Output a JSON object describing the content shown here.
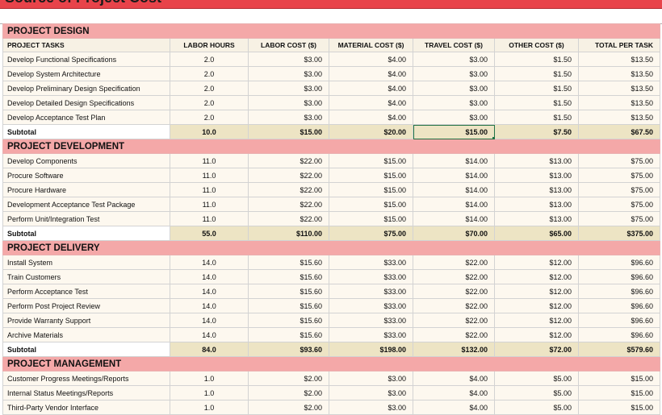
{
  "title": "Source of Project Cost",
  "columns": [
    "PROJECT TASKS",
    "LABOR HOURS",
    "LABOR COST ($)",
    "MATERIAL COST ($)",
    "TRAVEL COST ($)",
    "OTHER COST ($)",
    "TOTAL PER TASK"
  ],
  "sections": [
    {
      "name": "PROJECT DESIGN",
      "rows": [
        [
          "Develop Functional Specifications",
          "2.0",
          "$3.00",
          "$4.00",
          "$3.00",
          "$1.50",
          "$13.50"
        ],
        [
          "Develop System Architecture",
          "2.0",
          "$3.00",
          "$4.00",
          "$3.00",
          "$1.50",
          "$13.50"
        ],
        [
          "Develop Preliminary Design Specification",
          "2.0",
          "$3.00",
          "$4.00",
          "$3.00",
          "$1.50",
          "$13.50"
        ],
        [
          "Develop Detailed Design Specifications",
          "2.0",
          "$3.00",
          "$4.00",
          "$3.00",
          "$1.50",
          "$13.50"
        ],
        [
          "Develop Acceptance Test Plan",
          "2.0",
          "$3.00",
          "$4.00",
          "$3.00",
          "$1.50",
          "$13.50"
        ]
      ],
      "subtotal": [
        "Subtotal",
        "10.0",
        "$15.00",
        "$20.00",
        "$15.00",
        "$7.50",
        "$67.50"
      ]
    },
    {
      "name": "PROJECT DEVELOPMENT",
      "rows": [
        [
          "Develop Components",
          "11.0",
          "$22.00",
          "$15.00",
          "$14.00",
          "$13.00",
          "$75.00"
        ],
        [
          "Procure Software",
          "11.0",
          "$22.00",
          "$15.00",
          "$14.00",
          "$13.00",
          "$75.00"
        ],
        [
          "Procure Hardware",
          "11.0",
          "$22.00",
          "$15.00",
          "$14.00",
          "$13.00",
          "$75.00"
        ],
        [
          "Development Acceptance Test Package",
          "11.0",
          "$22.00",
          "$15.00",
          "$14.00",
          "$13.00",
          "$75.00"
        ],
        [
          "Perform Unit/Integration Test",
          "11.0",
          "$22.00",
          "$15.00",
          "$14.00",
          "$13.00",
          "$75.00"
        ]
      ],
      "subtotal": [
        "Subtotal",
        "55.0",
        "$110.00",
        "$75.00",
        "$70.00",
        "$65.00",
        "$375.00"
      ]
    },
    {
      "name": "PROJECT DELIVERY",
      "rows": [
        [
          "Install System",
          "14.0",
          "$15.60",
          "$33.00",
          "$22.00",
          "$12.00",
          "$96.60"
        ],
        [
          "Train Customers",
          "14.0",
          "$15.60",
          "$33.00",
          "$22.00",
          "$12.00",
          "$96.60"
        ],
        [
          "Perform Acceptance Test",
          "14.0",
          "$15.60",
          "$33.00",
          "$22.00",
          "$12.00",
          "$96.60"
        ],
        [
          "Perform Post Project Review",
          "14.0",
          "$15.60",
          "$33.00",
          "$22.00",
          "$12.00",
          "$96.60"
        ],
        [
          "Provide Warranty Support",
          "14.0",
          "$15.60",
          "$33.00",
          "$22.00",
          "$12.00",
          "$96.60"
        ],
        [
          "Archive Materials",
          "14.0",
          "$15.60",
          "$33.00",
          "$22.00",
          "$12.00",
          "$96.60"
        ]
      ],
      "subtotal": [
        "Subtotal",
        "84.0",
        "$93.60",
        "$198.00",
        "$132.00",
        "$72.00",
        "$579.60"
      ]
    },
    {
      "name": "PROJECT  MANAGEMENT",
      "rows": [
        [
          "Customer Progress Meetings/Reports",
          "1.0",
          "$2.00",
          "$3.00",
          "$4.00",
          "$5.00",
          "$15.00"
        ],
        [
          "Internal Status Meetings/Reports",
          "1.0",
          "$2.00",
          "$3.00",
          "$4.00",
          "$5.00",
          "$15.00"
        ],
        [
          "Third-Party Vendor Interface",
          "1.0",
          "$2.00",
          "$3.00",
          "$4.00",
          "$5.00",
          "$15.00"
        ]
      ]
    }
  ],
  "selected_cell": {
    "section": 0,
    "column": 4
  },
  "colors": {
    "title_bar": "#e8434a",
    "section_band": "#f4a8a8",
    "subtotal_fill": "#ede4c4",
    "row_fill": "#fdf8ef",
    "selection": "#217346"
  }
}
